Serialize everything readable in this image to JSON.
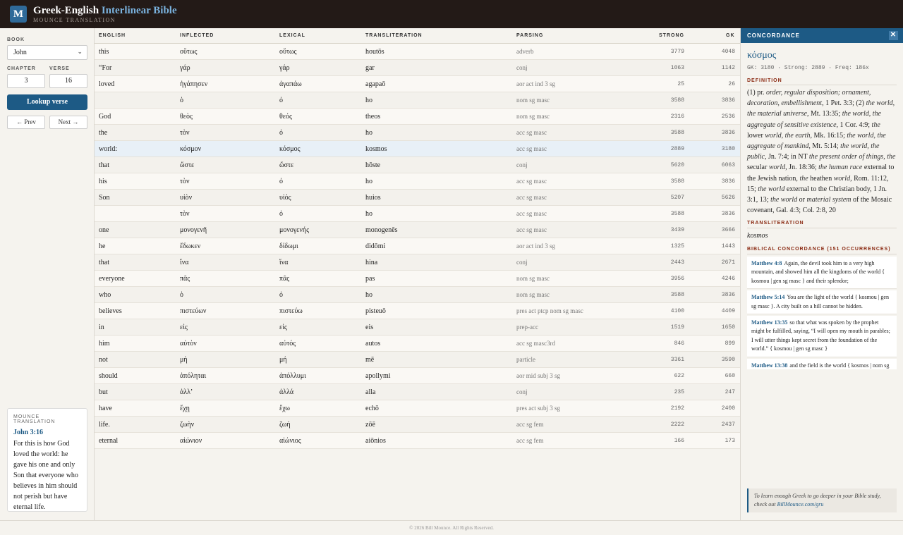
{
  "header": {
    "logo_letter": "M",
    "title_main": "Greek-English",
    "title_accent": "Interlinear Bible",
    "subtitle": "MOUNCE TRANSLATION"
  },
  "sidebar": {
    "book_label": "BOOK",
    "book_value": "John",
    "chapter_label": "CHAPTER",
    "chapter_value": "3",
    "verse_label": "VERSE",
    "verse_value": "16",
    "lookup_label": "Lookup verse",
    "prev_label": "← Prev",
    "next_label": "Next →",
    "translation_box": {
      "label": "MOUNCE TRANSLATION",
      "reference": "John 3:16",
      "text": "For this is how God loved the world: he gave his one and only Son that everyone who believes in him should not perish but have eternal life."
    }
  },
  "table": {
    "headers": [
      "ENGLISH",
      "INFLECTED",
      "LEXICAL",
      "TRANSLITERATION",
      "PARSING",
      "STRONG",
      "GK"
    ],
    "rows": [
      {
        "english": "this",
        "inflected": "οὕτως",
        "lexical": "οὕτως",
        "translit": "houtōs",
        "parsing": "adverb",
        "strong": "3779",
        "gk": "4048"
      },
      {
        "english": "“For",
        "inflected": "γάρ",
        "lexical": "γάρ",
        "translit": "gar",
        "parsing": "conj",
        "strong": "1063",
        "gk": "1142"
      },
      {
        "english": "loved",
        "inflected": "ἠγάπησεν",
        "lexical": "ἀγαπάω",
        "translit": "agapaō",
        "parsing": "aor act ind 3 sg",
        "strong": "25",
        "gk": "26"
      },
      {
        "english": "",
        "inflected": "ὁ",
        "lexical": "ὁ",
        "translit": "ho",
        "parsing": "nom sg masc",
        "strong": "3588",
        "gk": "3836"
      },
      {
        "english": "God",
        "inflected": "θεὸς",
        "lexical": "θεός",
        "translit": "theos",
        "parsing": "nom sg masc",
        "strong": "2316",
        "gk": "2536"
      },
      {
        "english": "the",
        "inflected": "τὸν",
        "lexical": "ὁ",
        "translit": "ho",
        "parsing": "acc sg masc",
        "strong": "3588",
        "gk": "3836"
      },
      {
        "english": "world:",
        "inflected": "κόσμον",
        "lexical": "κόσμος",
        "translit": "kosmos",
        "parsing": "acc sg masc",
        "strong": "2889",
        "gk": "3180"
      },
      {
        "english": "that",
        "inflected": "ὥστε",
        "lexical": "ὥστε",
        "translit": "hōste",
        "parsing": "conj",
        "strong": "5620",
        "gk": "6063"
      },
      {
        "english": "his",
        "inflected": "τὸν",
        "lexical": "ὁ",
        "translit": "ho",
        "parsing": "acc sg masc",
        "strong": "3588",
        "gk": "3836"
      },
      {
        "english": "Son",
        "inflected": "υἱὸν",
        "lexical": "υἱός",
        "translit": "huios",
        "parsing": "acc sg masc",
        "strong": "5207",
        "gk": "5626"
      },
      {
        "english": "",
        "inflected": "τὸν",
        "lexical": "ὁ",
        "translit": "ho",
        "parsing": "acc sg masc",
        "strong": "3588",
        "gk": "3836"
      },
      {
        "english": "one",
        "inflected": "μονογενῆ",
        "lexical": "μονογενής",
        "translit": "monogenēs",
        "parsing": "acc sg masc",
        "strong": "3439",
        "gk": "3666"
      },
      {
        "english": "he",
        "inflected": "ἔδωκεν",
        "lexical": "δίδωμι",
        "translit": "didōmi",
        "parsing": "aor act ind 3 sg",
        "strong": "1325",
        "gk": "1443"
      },
      {
        "english": "that",
        "inflected": "ἵνα",
        "lexical": "ἵνα",
        "translit": "hina",
        "parsing": "conj",
        "strong": "2443",
        "gk": "2671"
      },
      {
        "english": "everyone",
        "inflected": "πᾶς",
        "lexical": "πᾶς",
        "translit": "pas",
        "parsing": "nom sg masc",
        "strong": "3956",
        "gk": "4246"
      },
      {
        "english": "who",
        "inflected": "ὁ",
        "lexical": "ὁ",
        "translit": "ho",
        "parsing": "nom sg masc",
        "strong": "3588",
        "gk": "3836"
      },
      {
        "english": "believes",
        "inflected": "πιστεύων",
        "lexical": "πιστεύω",
        "translit": "pisteuō",
        "parsing": "pres act ptcp nom sg masc",
        "strong": "4100",
        "gk": "4409"
      },
      {
        "english": "in",
        "inflected": "εἰς",
        "lexical": "εἰς",
        "translit": "eis",
        "parsing": "prep-acc",
        "strong": "1519",
        "gk": "1650"
      },
      {
        "english": "him",
        "inflected": "αὐτὸν",
        "lexical": "αὐτός",
        "translit": "autos",
        "parsing": "acc sg masc3rd",
        "strong": "846",
        "gk": "899"
      },
      {
        "english": "not",
        "inflected": "μὴ",
        "lexical": "μή",
        "translit": "mē",
        "parsing": "particle",
        "strong": "3361",
        "gk": "3590"
      },
      {
        "english": "should",
        "inflected": "ἀπόληται",
        "lexical": "ἀπόλλυμι",
        "translit": "apollymi",
        "parsing": "aor mid subj 3 sg",
        "strong": "622",
        "gk": "660"
      },
      {
        "english": "but",
        "inflected": "ἀλλʼ",
        "lexical": "ἀλλά",
        "translit": "alla",
        "parsing": "conj",
        "strong": "235",
        "gk": "247"
      },
      {
        "english": "have",
        "inflected": "ἔχῃ",
        "lexical": "ἔχω",
        "translit": "echō",
        "parsing": "pres act subj 3 sg",
        "strong": "2192",
        "gk": "2400"
      },
      {
        "english": "life.",
        "inflected": "ζωὴν",
        "lexical": "ζωή",
        "translit": "zōē",
        "parsing": "acc sg fem",
        "strong": "2222",
        "gk": "2437"
      },
      {
        "english": "eternal",
        "inflected": "αἰώνιον",
        "lexical": "αἰώνιος",
        "translit": "aiōnios",
        "parsing": "acc sg fem",
        "strong": "166",
        "gk": "173"
      }
    ],
    "selected_index": 6
  },
  "concordance": {
    "header_label": "CONCORDANCE",
    "close_glyph": "✕",
    "lemma": "κόσμος",
    "meta": "GK: 3180 · Strong: 2889 · Freq: 186x",
    "definition_label": "DEFINITION",
    "transliteration_label": "TRANSLITERATION",
    "transliteration": "kosmos",
    "biblical_label": "BIBLICAL CONCORDANCE (151 OCCURRENCES)",
    "verses": [
      {
        "ref": "Matthew 4:8",
        "text": "Again, the devil took him to a very high mountain, and showed him all the kingdoms of the world { kosmou | gen sg masc } and their splendor;"
      },
      {
        "ref": "Matthew 5:14",
        "text": "You are the light of the world { kosmou | gen sg masc }. A city built on a hill cannot be hidden."
      },
      {
        "ref": "Matthew 13:35",
        "text": "so that what was spoken by the prophet might be fulfilled, saying, “I will open my mouth in parables; I will utter things kept secret from the foundation of the world.” { kosmou | gen sg masc }"
      },
      {
        "ref": "Matthew 13:38",
        "text": "and the field is the world { kosmos | nom sg masc }; and the good seed, these are the sons of the kingdom;"
      }
    ],
    "note_text": "To learn enough Greek to go deeper in your Bible study, check out",
    "note_link": "BillMounce.com/gru"
  },
  "footer": {
    "text": "© 2026 Bill Mounce. All Rights Reserved."
  }
}
